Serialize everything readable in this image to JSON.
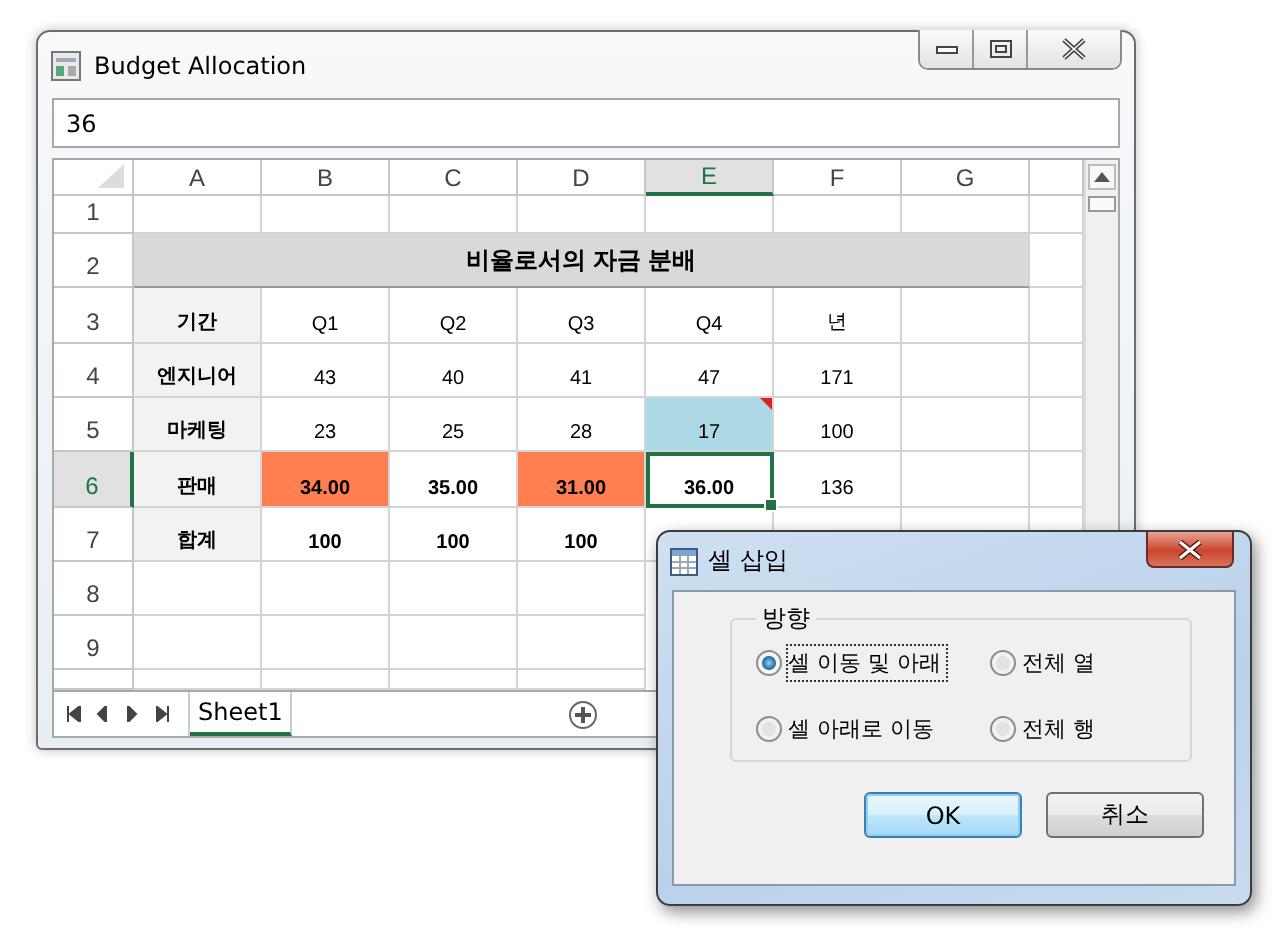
{
  "window": {
    "title": "Budget Allocation"
  },
  "formula_bar": {
    "value": "36"
  },
  "columns": [
    {
      "label": "A",
      "selected": false
    },
    {
      "label": "B",
      "selected": false
    },
    {
      "label": "C",
      "selected": false
    },
    {
      "label": "D",
      "selected": false
    },
    {
      "label": "E",
      "selected": true
    },
    {
      "label": "F",
      "selected": false
    },
    {
      "label": "G",
      "selected": false
    }
  ],
  "rows": [
    {
      "header": "1",
      "selected": false,
      "kind": "cells",
      "cells": [
        {
          "selected": false
        },
        {
          "selected": false
        },
        {
          "selected": false
        },
        {
          "selected": false
        },
        {
          "selected": false
        },
        {
          "selected": false
        },
        {
          "selected": false
        }
      ]
    },
    {
      "header": "2",
      "selected": false,
      "kind": "title",
      "text": "비율로서의 자금 분배"
    },
    {
      "header": "3",
      "selected": false,
      "kind": "cells",
      "cells": [
        {
          "text": "기간",
          "bold": true,
          "color": "#f2f2f2",
          "selected": false
        },
        {
          "text": "Q1",
          "selected": false
        },
        {
          "text": "Q2",
          "selected": false
        },
        {
          "text": "Q3",
          "selected": false
        },
        {
          "text": "Q4",
          "selected": false
        },
        {
          "text": "년",
          "selected": false
        },
        {
          "selected": false
        }
      ]
    },
    {
      "header": "4",
      "selected": false,
      "kind": "cells",
      "cells": [
        {
          "text": "엔지니어",
          "bold": true,
          "color": "#f2f2f2",
          "selected": false
        },
        {
          "text": "43",
          "selected": false
        },
        {
          "text": "40",
          "selected": false
        },
        {
          "text": "41",
          "selected": false
        },
        {
          "text": "47",
          "selected": false
        },
        {
          "text": "171",
          "selected": false
        },
        {
          "selected": false
        }
      ]
    },
    {
      "header": "5",
      "selected": false,
      "kind": "cells",
      "cells": [
        {
          "text": "마케팅",
          "bold": true,
          "color": "#f2f2f2",
          "selected": false
        },
        {
          "text": "23",
          "selected": false
        },
        {
          "text": "25",
          "selected": false
        },
        {
          "text": "28",
          "selected": false
        },
        {
          "text": "17",
          "color": "#add8e6",
          "comment": true,
          "selected": false
        },
        {
          "text": "100",
          "selected": false
        },
        {
          "selected": false
        }
      ]
    },
    {
      "header": "6",
      "selected": true,
      "kind": "cells",
      "cells": [
        {
          "text": "판매",
          "bold": true,
          "color": "#f2f2f2",
          "selected": false
        },
        {
          "text": "34.00",
          "bold": true,
          "color": "#ff7f50",
          "selected": false
        },
        {
          "text": "35.00",
          "bold": true,
          "selected": false
        },
        {
          "text": "31.00",
          "bold": true,
          "color": "#ff7f50",
          "selected": false
        },
        {
          "text": "36.00",
          "bold": true,
          "selected": true
        },
        {
          "text": "136",
          "selected": false
        },
        {
          "selected": false
        }
      ]
    },
    {
      "header": "7",
      "selected": false,
      "kind": "cells",
      "cells": [
        {
          "text": "합계",
          "bold": true,
          "color": "#f2f2f2",
          "selected": false
        },
        {
          "text": "100",
          "bold": true,
          "selected": false
        },
        {
          "text": "100",
          "bold": true,
          "selected": false
        },
        {
          "text": "100",
          "bold": true,
          "selected": false
        },
        {
          "selected": false
        },
        {
          "selected": false
        },
        {
          "selected": false
        }
      ]
    },
    {
      "header": "8",
      "selected": false,
      "kind": "cells",
      "cells": [
        {
          "selected": false
        },
        {
          "selected": false
        },
        {
          "selected": false
        },
        {
          "selected": false
        }
      ]
    },
    {
      "header": "9",
      "selected": false,
      "kind": "cells",
      "cells": [
        {
          "selected": false
        },
        {
          "selected": false
        },
        {
          "selected": false
        },
        {
          "selected": false
        }
      ]
    }
  ],
  "sheet_tabs": [
    {
      "label": "Sheet1",
      "selected": true
    }
  ],
  "dialog": {
    "title": "셀 삽입",
    "group": "방향",
    "options": [
      {
        "label": "셀 이동 및 아래",
        "selected": true,
        "focused": true
      },
      {
        "label": "전체 열",
        "selected": false,
        "focused": false
      },
      {
        "label": "셀 아래로 이동",
        "selected": false,
        "focused": false
      },
      {
        "label": "전체 행",
        "selected": false,
        "focused": false
      }
    ],
    "buttons": [
      {
        "label": "OK",
        "default": true
      },
      {
        "label": "취소",
        "default": false
      }
    ]
  }
}
